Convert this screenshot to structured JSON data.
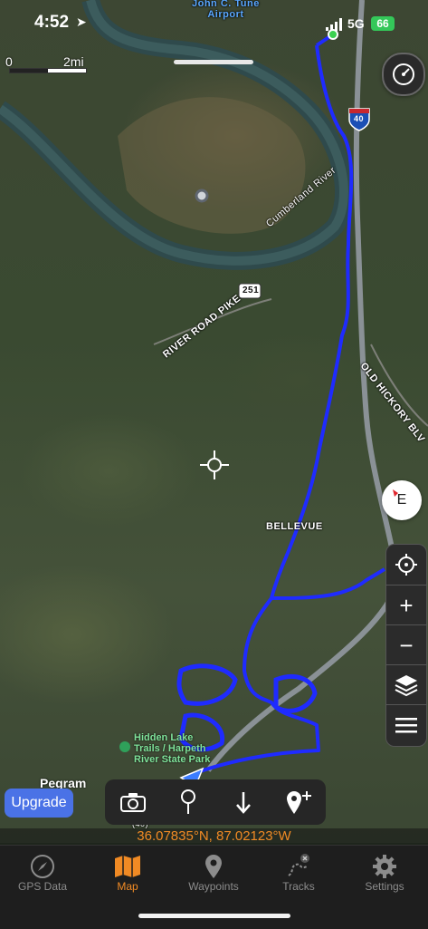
{
  "status_bar": {
    "time": "4:52",
    "network": "5G",
    "battery": "66"
  },
  "map": {
    "scale_start": "0",
    "scale_end": "2mi",
    "labels": {
      "airport": "John C. Tune\nAirport",
      "river": "Cumberland River",
      "road1": "RIVER ROAD PIKE",
      "road2": "OLD HICKORY BLV",
      "route_251": "251",
      "interstate_40": "40",
      "bellevue": "BELLEVUE",
      "park": "Hidden Lake\nTrails / Harpeth\nRiver State Park",
      "pegram": "Pegram",
      "route_40": "(40)"
    }
  },
  "controls": {
    "speedometer": "speedometer-icon",
    "compass_letter": "E",
    "toolbar": [
      "locate-icon",
      "zoom-in-icon",
      "zoom-out-icon",
      "layers-icon",
      "menu-icon"
    ]
  },
  "upgrade_label": "Upgrade",
  "action_bar": [
    "camera-icon",
    "pin-icon",
    "down-arrow-icon",
    "add-waypoint-icon"
  ],
  "coordinates": "36.07835°N, 87.02123°W",
  "tabs": [
    {
      "label": "GPS Data",
      "icon": "compass-icon"
    },
    {
      "label": "Map",
      "icon": "map-icon",
      "active": true
    },
    {
      "label": "Waypoints",
      "icon": "waypoint-pin-icon"
    },
    {
      "label": "Tracks",
      "icon": "tracks-icon"
    },
    {
      "label": "Settings",
      "icon": "gear-icon"
    }
  ],
  "colors": {
    "accent": "#f08a24",
    "track": "#1f2bff",
    "upgrade": "#4a72e6"
  }
}
